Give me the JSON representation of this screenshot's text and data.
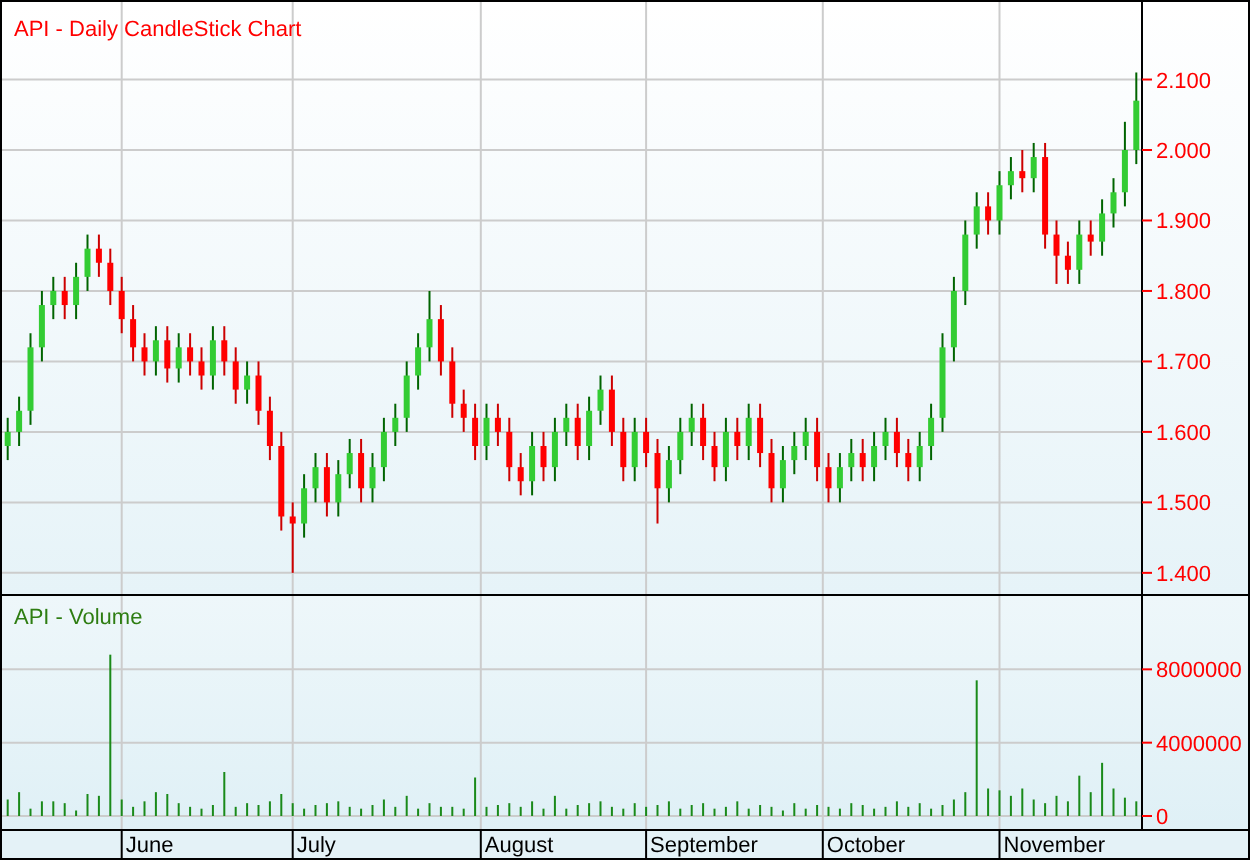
{
  "price_panel": {
    "chart_data": {
      "type": "candlestick",
      "title": "API - Daily CandleStick Chart",
      "grid": true,
      "ylim": [
        1.37,
        2.21
      ],
      "yticks": [
        {
          "value": 2.1,
          "label": "2.100"
        },
        {
          "value": 2.0,
          "label": "2.000"
        },
        {
          "value": 1.9,
          "label": "1.900"
        },
        {
          "value": 1.8,
          "label": "1.800"
        },
        {
          "value": 1.7,
          "label": "1.700"
        },
        {
          "value": 1.6,
          "label": "1.600"
        },
        {
          "value": 1.5,
          "label": "1.500"
        },
        {
          "value": 1.4,
          "label": "1.400"
        }
      ],
      "categories": [
        null,
        null,
        null,
        null,
        null,
        null,
        null,
        null,
        null,
        null,
        null,
        null,
        null,
        null,
        null,
        null,
        null,
        null,
        null,
        null,
        null,
        null,
        null,
        null,
        null,
        null,
        null,
        null,
        null,
        null,
        null,
        null,
        null,
        null,
        null,
        null,
        null,
        null,
        null,
        null,
        null,
        null,
        null,
        null,
        null,
        null,
        null,
        null,
        null,
        null,
        null,
        null,
        null,
        null,
        null,
        null,
        null,
        null,
        null,
        null,
        null,
        null,
        null,
        null,
        null,
        null,
        null,
        null,
        null,
        null,
        null,
        null,
        null,
        null,
        null,
        null,
        null,
        null,
        null,
        null,
        null,
        null,
        null,
        null,
        null,
        null,
        null,
        null,
        null,
        null,
        null,
        null,
        null,
        null,
        null,
        null,
        null,
        null,
        null,
        null
      ],
      "ohlc": [
        [
          1.58,
          1.62,
          1.56,
          1.6
        ],
        [
          1.6,
          1.65,
          1.58,
          1.63
        ],
        [
          1.63,
          1.74,
          1.61,
          1.72
        ],
        [
          1.72,
          1.8,
          1.7,
          1.78
        ],
        [
          1.78,
          1.82,
          1.76,
          1.8
        ],
        [
          1.8,
          1.82,
          1.76,
          1.78
        ],
        [
          1.78,
          1.84,
          1.76,
          1.82
        ],
        [
          1.82,
          1.88,
          1.8,
          1.86
        ],
        [
          1.86,
          1.88,
          1.82,
          1.84
        ],
        [
          1.84,
          1.86,
          1.78,
          1.8
        ],
        [
          1.8,
          1.82,
          1.74,
          1.76
        ],
        [
          1.76,
          1.78,
          1.7,
          1.72
        ],
        [
          1.72,
          1.74,
          1.68,
          1.7
        ],
        [
          1.7,
          1.75,
          1.68,
          1.73
        ],
        [
          1.73,
          1.75,
          1.67,
          1.69
        ],
        [
          1.69,
          1.74,
          1.67,
          1.72
        ],
        [
          1.72,
          1.74,
          1.68,
          1.7
        ],
        [
          1.7,
          1.72,
          1.66,
          1.68
        ],
        [
          1.68,
          1.75,
          1.66,
          1.73
        ],
        [
          1.73,
          1.75,
          1.68,
          1.7
        ],
        [
          1.7,
          1.72,
          1.64,
          1.66
        ],
        [
          1.66,
          1.7,
          1.64,
          1.68
        ],
        [
          1.68,
          1.7,
          1.61,
          1.63
        ],
        [
          1.63,
          1.65,
          1.56,
          1.58
        ],
        [
          1.58,
          1.6,
          1.46,
          1.48
        ],
        [
          1.48,
          1.5,
          1.4,
          1.47
        ],
        [
          1.47,
          1.54,
          1.45,
          1.52
        ],
        [
          1.52,
          1.57,
          1.5,
          1.55
        ],
        [
          1.55,
          1.57,
          1.48,
          1.5
        ],
        [
          1.5,
          1.56,
          1.48,
          1.54
        ],
        [
          1.54,
          1.59,
          1.52,
          1.57
        ],
        [
          1.57,
          1.59,
          1.5,
          1.52
        ],
        [
          1.52,
          1.57,
          1.5,
          1.55
        ],
        [
          1.55,
          1.62,
          1.53,
          1.6
        ],
        [
          1.6,
          1.64,
          1.58,
          1.62
        ],
        [
          1.62,
          1.7,
          1.6,
          1.68
        ],
        [
          1.68,
          1.74,
          1.66,
          1.72
        ],
        [
          1.72,
          1.8,
          1.7,
          1.76
        ],
        [
          1.76,
          1.78,
          1.68,
          1.7
        ],
        [
          1.7,
          1.72,
          1.62,
          1.64
        ],
        [
          1.64,
          1.66,
          1.6,
          1.62
        ],
        [
          1.62,
          1.64,
          1.56,
          1.58
        ],
        [
          1.58,
          1.64,
          1.56,
          1.62
        ],
        [
          1.62,
          1.64,
          1.58,
          1.6
        ],
        [
          1.6,
          1.62,
          1.53,
          1.55
        ],
        [
          1.55,
          1.57,
          1.51,
          1.53
        ],
        [
          1.53,
          1.6,
          1.51,
          1.58
        ],
        [
          1.58,
          1.6,
          1.53,
          1.55
        ],
        [
          1.55,
          1.62,
          1.53,
          1.6
        ],
        [
          1.6,
          1.64,
          1.58,
          1.62
        ],
        [
          1.62,
          1.64,
          1.56,
          1.58
        ],
        [
          1.58,
          1.65,
          1.56,
          1.63
        ],
        [
          1.63,
          1.68,
          1.61,
          1.66
        ],
        [
          1.66,
          1.68,
          1.58,
          1.6
        ],
        [
          1.6,
          1.62,
          1.53,
          1.55
        ],
        [
          1.55,
          1.62,
          1.53,
          1.6
        ],
        [
          1.6,
          1.62,
          1.55,
          1.57
        ],
        [
          1.57,
          1.59,
          1.47,
          1.52
        ],
        [
          1.52,
          1.58,
          1.5,
          1.56
        ],
        [
          1.56,
          1.62,
          1.54,
          1.6
        ],
        [
          1.6,
          1.64,
          1.58,
          1.62
        ],
        [
          1.62,
          1.64,
          1.56,
          1.58
        ],
        [
          1.58,
          1.6,
          1.53,
          1.55
        ],
        [
          1.55,
          1.62,
          1.53,
          1.6
        ],
        [
          1.6,
          1.62,
          1.56,
          1.58
        ],
        [
          1.58,
          1.64,
          1.56,
          1.62
        ],
        [
          1.62,
          1.64,
          1.55,
          1.57
        ],
        [
          1.57,
          1.59,
          1.5,
          1.52
        ],
        [
          1.52,
          1.58,
          1.5,
          1.56
        ],
        [
          1.56,
          1.6,
          1.54,
          1.58
        ],
        [
          1.58,
          1.62,
          1.56,
          1.6
        ],
        [
          1.6,
          1.62,
          1.53,
          1.55
        ],
        [
          1.55,
          1.57,
          1.5,
          1.52
        ],
        [
          1.52,
          1.57,
          1.5,
          1.55
        ],
        [
          1.55,
          1.59,
          1.53,
          1.57
        ],
        [
          1.57,
          1.59,
          1.53,
          1.55
        ],
        [
          1.55,
          1.6,
          1.53,
          1.58
        ],
        [
          1.58,
          1.62,
          1.56,
          1.6
        ],
        [
          1.6,
          1.62,
          1.55,
          1.57
        ],
        [
          1.57,
          1.59,
          1.53,
          1.55
        ],
        [
          1.55,
          1.6,
          1.53,
          1.58
        ],
        [
          1.58,
          1.64,
          1.56,
          1.62
        ],
        [
          1.62,
          1.74,
          1.6,
          1.72
        ],
        [
          1.72,
          1.82,
          1.7,
          1.8
        ],
        [
          1.8,
          1.9,
          1.78,
          1.88
        ],
        [
          1.88,
          1.94,
          1.86,
          1.92
        ],
        [
          1.92,
          1.94,
          1.88,
          1.9
        ],
        [
          1.9,
          1.97,
          1.88,
          1.95
        ],
        [
          1.95,
          1.99,
          1.93,
          1.97
        ],
        [
          1.97,
          2.0,
          1.94,
          1.96
        ],
        [
          1.96,
          2.01,
          1.94,
          1.99
        ],
        [
          1.99,
          2.01,
          1.86,
          1.88
        ],
        [
          1.88,
          1.9,
          1.81,
          1.85
        ],
        [
          1.85,
          1.87,
          1.81,
          1.83
        ],
        [
          1.83,
          1.9,
          1.81,
          1.88
        ],
        [
          1.88,
          1.9,
          1.85,
          1.87
        ],
        [
          1.87,
          1.93,
          1.85,
          1.91
        ],
        [
          1.91,
          1.96,
          1.89,
          1.94
        ],
        [
          1.94,
          2.04,
          1.92,
          2.0
        ],
        [
          2.0,
          2.11,
          1.98,
          2.07
        ]
      ]
    }
  },
  "volume_panel": {
    "chart_data": {
      "type": "bar",
      "title": "API - Volume",
      "grid": true,
      "ylim": [
        0,
        12000000
      ],
      "yticks": [
        {
          "value": 8000000,
          "label": "8000000"
        },
        {
          "value": 4000000,
          "label": "4000000"
        },
        {
          "value": 0,
          "label": "0"
        }
      ],
      "categories": [
        null,
        null,
        null,
        null,
        null,
        null,
        null,
        null,
        null,
        null,
        null,
        null,
        null,
        null,
        null,
        null,
        null,
        null,
        null,
        null,
        null,
        null,
        null,
        null,
        null,
        null,
        null,
        null,
        null,
        null,
        null,
        null,
        null,
        null,
        null,
        null,
        null,
        null,
        null,
        null,
        null,
        null,
        null,
        null,
        null,
        null,
        null,
        null,
        null,
        null,
        null,
        null,
        null,
        null,
        null,
        null,
        null,
        null,
        null,
        null,
        null,
        null,
        null,
        null,
        null,
        null,
        null,
        null,
        null,
        null,
        null,
        null,
        null,
        null,
        null,
        null,
        null,
        null,
        null,
        null,
        null,
        null,
        null,
        null,
        null,
        null,
        null,
        null,
        null,
        null,
        null,
        null,
        null,
        null,
        null,
        null,
        null,
        null,
        null,
        null
      ],
      "values": [
        900000,
        1300000,
        400000,
        800000,
        800000,
        700000,
        300000,
        1200000,
        1100000,
        8800000,
        900000,
        500000,
        800000,
        1300000,
        1200000,
        700000,
        500000,
        400000,
        600000,
        2400000,
        500000,
        700000,
        600000,
        800000,
        1200000,
        700000,
        400000,
        600000,
        700000,
        800000,
        500000,
        400000,
        600000,
        900000,
        500000,
        1100000,
        400000,
        700000,
        500000,
        500000,
        400000,
        2100000,
        500000,
        600000,
        700000,
        500000,
        800000,
        400000,
        1100000,
        400000,
        600000,
        700000,
        800000,
        500000,
        400000,
        700000,
        500000,
        600000,
        800000,
        400000,
        600000,
        700000,
        400000,
        500000,
        800000,
        400000,
        600000,
        500000,
        300000,
        700000,
        400000,
        600000,
        500000,
        400000,
        700000,
        600000,
        400000,
        500000,
        800000,
        500000,
        700000,
        400000,
        600000,
        900000,
        1300000,
        7400000,
        1500000,
        1400000,
        1100000,
        1500000,
        900000,
        700000,
        1100000,
        800000,
        2200000,
        1300000,
        2900000,
        1500000,
        1000000,
        800000
      ]
    }
  },
  "x_axis": {
    "months": [
      "June",
      "July",
      "August",
      "September",
      "October",
      "November"
    ]
  }
}
